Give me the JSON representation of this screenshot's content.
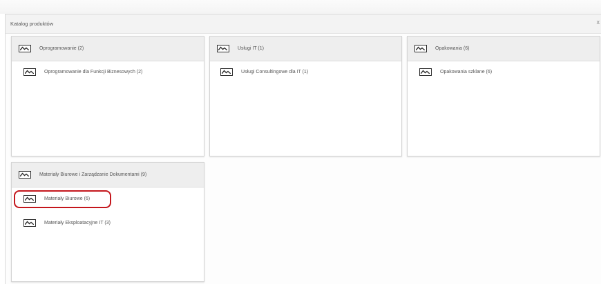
{
  "panel": {
    "title": "Katalog produktów",
    "close_glyph": "x"
  },
  "categories": [
    {
      "label": "Oprogramowanie (2)",
      "icon": "image-icon",
      "subcategories": [
        {
          "label": "Oprogramowanie dla Funkcji Biznesowych (2)",
          "icon": "image-icon"
        }
      ]
    },
    {
      "label": "Usługi IT (1)",
      "icon": "image-icon",
      "subcategories": [
        {
          "label": "Usługi Consultingowe dla IT (1)",
          "icon": "image-icon"
        }
      ]
    },
    {
      "label": "Opakowania (6)",
      "icon": "image-icon",
      "subcategories": [
        {
          "label": "Opakowania szklane (6)",
          "icon": "image-icon"
        }
      ]
    },
    {
      "label": "Materiały Biurowe i Zarządzanie Dokumentami (9)",
      "icon": "image-icon",
      "subcategories": [
        {
          "label": "Materiały Biurowe (6)",
          "icon": "image-icon",
          "highlighted": true
        },
        {
          "label": "Materiały Eksploatacyjne IT (3)",
          "icon": "image-icon"
        }
      ]
    }
  ],
  "colors": {
    "highlight": "#c4161c",
    "card_header_bg": "#eeeeee",
    "icon_stroke": "#2c2c2c"
  }
}
